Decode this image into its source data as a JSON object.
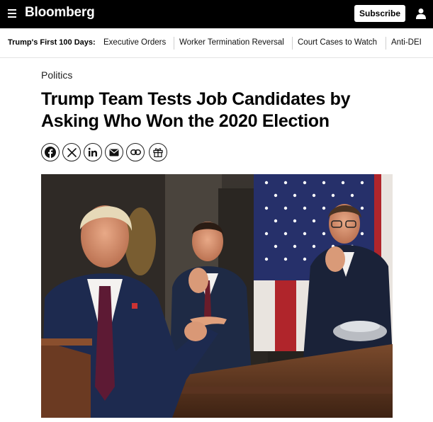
{
  "header": {
    "logo": "Bloomberg",
    "subscribe_label": "Subscribe",
    "menu_icon": "hamburger-menu-icon",
    "user_icon": "user-icon"
  },
  "nav": {
    "heading": "Trump's First 100 Days:",
    "items": [
      {
        "label": "Executive Orders"
      },
      {
        "label": "Worker Termination Reversal"
      },
      {
        "label": "Court Cases to Watch"
      },
      {
        "label": "Anti-DEI"
      }
    ]
  },
  "article": {
    "section": "Politics",
    "headline_line1": "Trump Team Tests Job Candidates by",
    "headline_line2": "Asking Who Won the 2020 Election",
    "share_icons": [
      "facebook-icon",
      "x-icon",
      "linkedin-icon",
      "email-icon",
      "link-icon",
      "gift-icon"
    ]
  },
  "colors": {
    "topbar": "#000000",
    "text": "#000000",
    "divider": "#e3e3e3"
  }
}
